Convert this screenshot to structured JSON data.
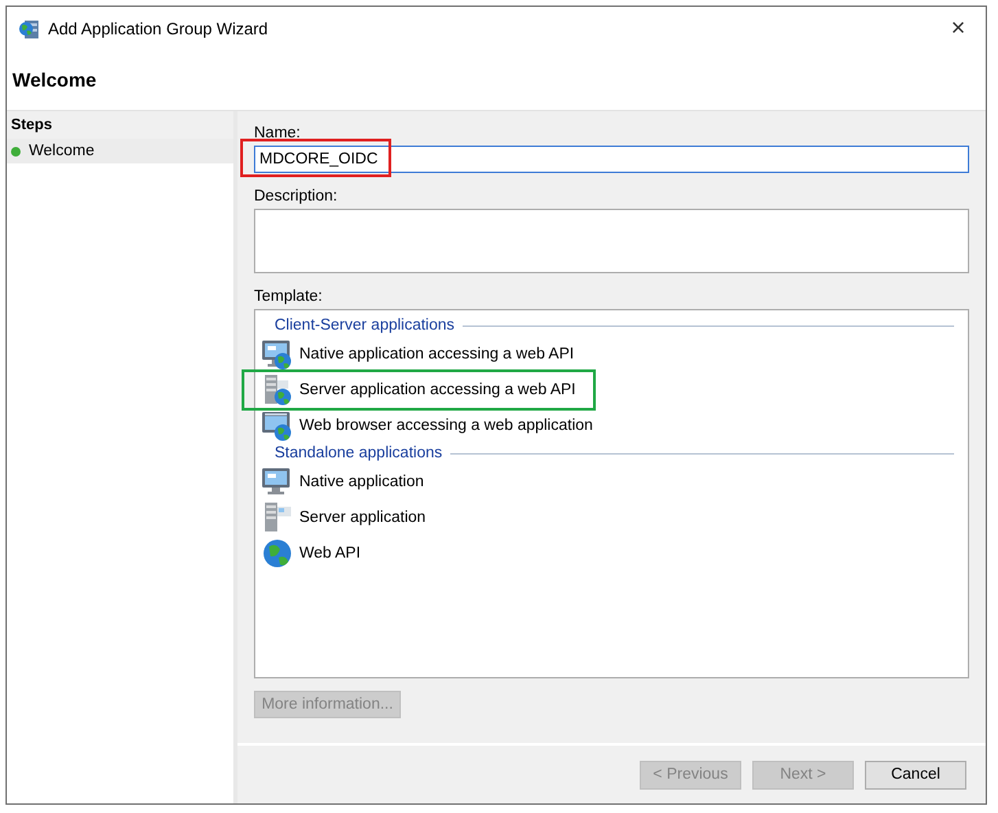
{
  "window": {
    "title": "Add Application Group Wizard",
    "close": "×"
  },
  "page_title": "Welcome",
  "steps": {
    "heading": "Steps",
    "items": [
      {
        "label": "Welcome",
        "selected": true
      }
    ]
  },
  "name": {
    "label": "Name:",
    "value": "MDCORE_OIDC",
    "annotated": true
  },
  "description": {
    "label": "Description:"
  },
  "template": {
    "label": "Template:",
    "groups": [
      {
        "title": "Client-Server applications",
        "items": [
          {
            "label": "Native application accessing a web API",
            "kind": "monitor-globe",
            "annotated": false
          },
          {
            "label": "Server application accessing a web API",
            "kind": "server-globe",
            "annotated": true
          },
          {
            "label": "Web browser accessing a web application",
            "kind": "browser-globe",
            "annotated": false
          }
        ]
      },
      {
        "title": "Standalone applications",
        "items": [
          {
            "label": "Native application",
            "kind": "monitor",
            "annotated": false
          },
          {
            "label": "Server application",
            "kind": "server",
            "annotated": false
          },
          {
            "label": "Web API",
            "kind": "globe",
            "annotated": false
          }
        ]
      }
    ]
  },
  "more_info": {
    "label": "More information...",
    "disabled": true
  },
  "buttons": [
    {
      "label": "< Previous",
      "disabled": true
    },
    {
      "label": "Next >",
      "disabled": true
    },
    {
      "label": "Cancel",
      "disabled": false
    }
  ]
}
